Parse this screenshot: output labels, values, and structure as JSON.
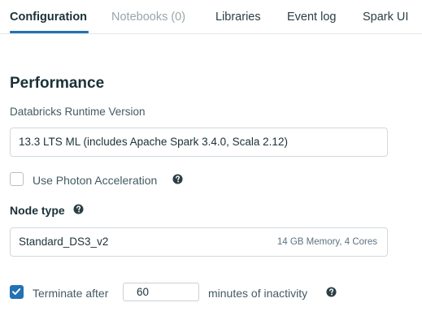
{
  "tabs": [
    {
      "label": "Configuration"
    },
    {
      "label": "Notebooks (0)"
    },
    {
      "label": "Libraries"
    },
    {
      "label": "Event log"
    },
    {
      "label": "Spark UI"
    }
  ],
  "performance": {
    "title": "Performance",
    "runtime_label": "Databricks Runtime Version",
    "runtime_value": "13.3 LTS ML (includes Apache Spark 3.4.0, Scala 2.12)",
    "photon_label": "Use Photon Acceleration",
    "photon_checked": false,
    "node_type_label": "Node type",
    "node_type_value": "Standard_DS3_v2",
    "node_type_meta": "14 GB Memory, 4 Cores",
    "terminate_label": "Terminate after",
    "terminate_checked": true,
    "terminate_minutes": "60",
    "terminate_suffix": "minutes of inactivity"
  },
  "colors": {
    "accent": "#2272b4",
    "text": "#1b3139",
    "muted": "#445a63"
  }
}
